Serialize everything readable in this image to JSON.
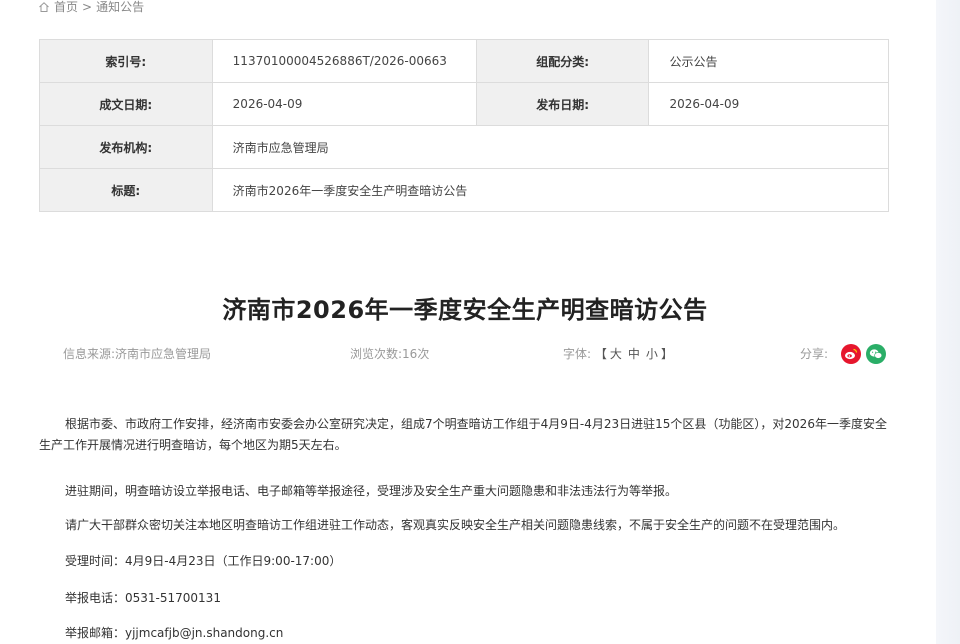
{
  "breadcrumb": {
    "home": "首页",
    "separator": ">",
    "current": "通知公告"
  },
  "meta_table": {
    "index_label": "索引号:",
    "index_value": "11370100004526886T/2026-00663",
    "category_label": "组配分类:",
    "category_value": "公示公告",
    "written_label": "成文日期:",
    "written_value": "2026-04-09",
    "published_label": "发布日期:",
    "published_value": "2026-04-09",
    "agency_label": "发布机构:",
    "agency_value": "济南市应急管理局",
    "subject_label": "标题:",
    "subject_value": "济南市2026年一季度安全生产明查暗访公告"
  },
  "article": {
    "title": "济南市2026年一季度安全生产明查暗访公告",
    "source_label": "信息来源:",
    "source_value": "济南市应急管理局",
    "views_label": "浏览次数:",
    "views_value": "16次",
    "font_label": "字体:",
    "font_open": "【",
    "font_large": "大",
    "font_medium": "中",
    "font_small": "小",
    "font_close": "】",
    "share_label": "分享:",
    "paragraphs": [
      "根据市委、市政府工作安排，经济南市安委会办公室研究决定，组成7个明查暗访工作组于4月9日-4月23日进驻15个区县（功能区），对2026年一季度安全生产工作开展情况进行明查暗访，每个地区为期5天左右。",
      "进驻期间，明查暗访设立举报电话、电子邮箱等举报途径，受理涉及安全生产重大问题隐患和非法违法行为等举报。",
      "请广大干部群众密切关注本地区明查暗访工作组进驻工作动态，客观真实反映安全生产相关问题隐患线索，不属于安全生产的问题不在受理范围内。",
      "受理时间：4月9日-4月23日（工作日9:00-17:00）",
      "举报电话：0531-51700131",
      "举报邮箱：yjjmcafjb@jn.shandong.cn"
    ]
  },
  "colors": {
    "weibo": "#e6162d",
    "wechat": "#2aae67",
    "label_bg": "#f0f0f0"
  },
  "icons": {
    "home": "home-icon",
    "weibo": "weibo-icon",
    "wechat": "wechat-icon"
  }
}
